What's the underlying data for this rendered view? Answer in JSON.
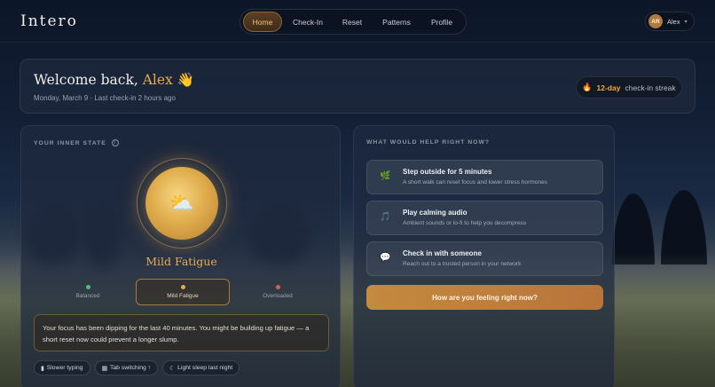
{
  "app": {
    "brand": "Intero"
  },
  "nav": {
    "items": [
      {
        "label": "Home",
        "active": true
      },
      {
        "label": "Check-In"
      },
      {
        "label": "Reset"
      },
      {
        "label": "Patterns"
      },
      {
        "label": "Profile"
      }
    ]
  },
  "user": {
    "initials": "AR",
    "name": "Alex"
  },
  "welcome": {
    "greeting": "Welcome back,",
    "name": "Alex",
    "wave": "👋",
    "subtitle": "Monday, March 9 · Last check-in 2 hours ago"
  },
  "streak": {
    "icon": "🔥",
    "days": "12-day",
    "label": "check-in streak"
  },
  "inner_state": {
    "section_label": "YOUR INNER STATE",
    "info_icon": "i",
    "orb_icon": "⛅",
    "state": "Mild Fatigue",
    "scale": [
      {
        "label": "Balanced",
        "color": "#4fbf77"
      },
      {
        "label": "Mild Fatigue",
        "color": "#e6a94c",
        "selected": true
      },
      {
        "label": "Overloaded",
        "color": "#d4634f"
      }
    ],
    "insight": "Your focus has been dipping for the last 40 minutes. You might be building up fatigue — a short reset now could prevent a longer slump.",
    "tags": [
      {
        "icon": "▮",
        "label": "Slower typing"
      },
      {
        "icon": "▦",
        "label": "Tab switching ↑"
      },
      {
        "icon": "☾",
        "label": "Light sleep last night"
      }
    ]
  },
  "help": {
    "section_label": "WHAT WOULD HELP RIGHT NOW?",
    "actions": [
      {
        "icon": "🌿",
        "title": "Step outside for 5 minutes",
        "desc": "A short walk can reset focus and lower stress hormones"
      },
      {
        "icon": "🎵",
        "title": "Play calming audio",
        "desc": "Ambient sounds or lo-fi to help you decompress"
      },
      {
        "icon": "💬",
        "title": "Check in with someone",
        "desc": "Reach out to a trusted person in your network"
      }
    ],
    "cta": "How are you feeling right now?"
  }
}
